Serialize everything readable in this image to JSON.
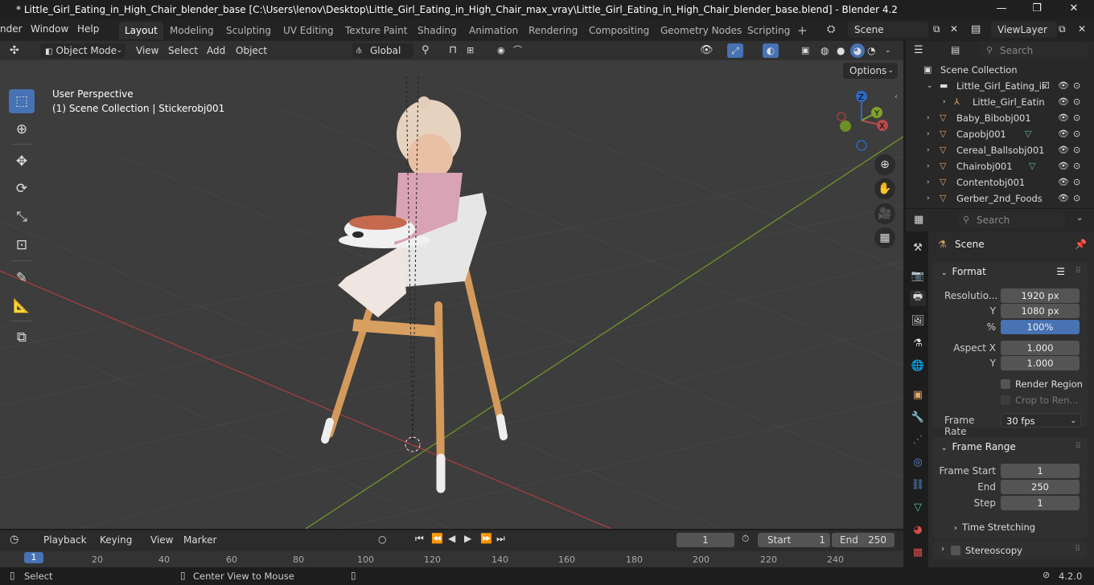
{
  "title_bar": {
    "title": "* Little_Girl_Eating_in_High_Chair_blender_base [C:\\Users\\lenov\\Desktop\\Little_Girl_Eating_in_High_Chair_max_vray\\Little_Girl_Eating_in_High_Chair_blender_base.blend] - Blender 4.2",
    "minimize": "—",
    "maximize": "❐",
    "close": "✕"
  },
  "menu": {
    "items": [
      "nder",
      "Window",
      "Help"
    ],
    "workspaces": [
      "Layout",
      "Modeling",
      "Sculpting",
      "UV Editing",
      "Texture Paint",
      "Shading",
      "Animation",
      "Rendering",
      "Compositing",
      "Geometry Nodes",
      "Scripting"
    ],
    "add_tab": "+",
    "scene_name": "Scene",
    "view_layer": "ViewLayer"
  },
  "viewport_header": {
    "mode": "Object Mode",
    "menus": [
      "View",
      "Select",
      "Add",
      "Object"
    ],
    "transform_orientation": "Global",
    "options": "Options"
  },
  "viewport": {
    "perspective": "User Perspective",
    "collection_info": "(1) Scene Collection | Stickerobj001",
    "gizmo": {
      "x": "X",
      "y": "Y",
      "z": "Z"
    }
  },
  "outliner": {
    "search_placeholder": "Search",
    "root": "Scene Collection",
    "rows": [
      {
        "name": "Little_Girl_Eating_ir",
        "type": "collection"
      },
      {
        "name": "Little_Girl_Eatin",
        "type": "armature"
      },
      {
        "name": "Baby_Bibobj001",
        "type": "mesh"
      },
      {
        "name": "Capobj001",
        "type": "mesh"
      },
      {
        "name": "Cereal_Ballsobj001",
        "type": "mesh"
      },
      {
        "name": "Chairobj001",
        "type": "mesh"
      },
      {
        "name": "Contentobj001",
        "type": "mesh"
      },
      {
        "name": "Gerber_2nd_Foods",
        "type": "mesh"
      }
    ]
  },
  "properties": {
    "search_placeholder": "Search",
    "context": "Scene",
    "format_panel": "Format",
    "resolution_label": "Resolutio...",
    "resolution_x": "1920 px",
    "y_label": "Y",
    "resolution_y": "1080 px",
    "percent_label": "%",
    "percent": "100%",
    "aspect_x_label": "Aspect X",
    "aspect_x": "1.000",
    "aspect_y": "1.000",
    "render_region": "Render Region",
    "crop": "Crop to Ren...",
    "frame_rate_label": "Frame Rate",
    "frame_rate": "30 fps",
    "frame_range_panel": "Frame Range",
    "frame_start_label": "Frame Start",
    "frame_start": "1",
    "end_label": "End",
    "end": "250",
    "step_label": "Step",
    "step": "1",
    "time_stretching": "Time Stretching",
    "stereoscopy": "Stereoscopy"
  },
  "timeline": {
    "menus": [
      "Playback",
      "Keying",
      "View",
      "Marker"
    ],
    "current_frame": "1",
    "start_label": "Start",
    "start": "1",
    "end_label": "End",
    "end": "250",
    "ticks": [
      "1",
      "20",
      "40",
      "60",
      "80",
      "100",
      "120",
      "140",
      "160",
      "180",
      "200",
      "220",
      "240"
    ]
  },
  "status_bar": {
    "select": "Select",
    "center_view": "Center View to Mouse",
    "version": "4.2.0"
  },
  "colors": {
    "accent": "#4772b3",
    "x_axis": "#b84a4a",
    "y_axis": "#7fa12c",
    "z_axis": "#2f67c4"
  }
}
